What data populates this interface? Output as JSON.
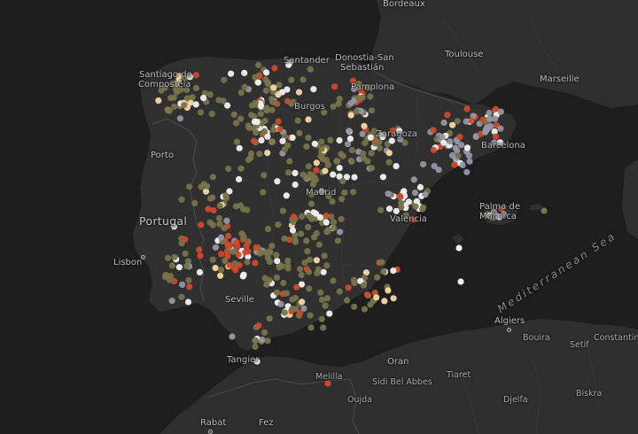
{
  "map": {
    "labels": {
      "bordeaux": "Bordeaux",
      "toulouse": "Toulouse",
      "marseille": "Marseille",
      "santiago_1": "Santiago de",
      "santiago_2": "Compostela",
      "santander": "Santander",
      "donostia_1": "Donostia-San",
      "donostia_2": "Sebastián",
      "pamplona": "Pamplona",
      "burgos": "Burgos",
      "zaragoza": "Zaragoza",
      "barcelona": "Barcelona",
      "porto": "Porto",
      "portugal": "Portugal",
      "lisbon": "Lisbon",
      "madrid": "Madrid",
      "valencia": "Valencia",
      "palma_1": "Palma de",
      "palma_2": "Mallorca",
      "seville": "Seville",
      "sea": "Mediterranean Sea",
      "algiers": "Algiers",
      "boufarik": "Bouira",
      "setif": "Setif",
      "constantine": "Constantine",
      "tangier": "Tangier",
      "oran": "Oran",
      "melilla": "Melilla",
      "sidibel": "Sidi Bel Abbes",
      "tiaret": "Tiaret",
      "oujda": "Oujda",
      "djelfa": "Djelfa",
      "biskra": "Biskra",
      "rabat": "Rabat",
      "fez": "Fez"
    }
  },
  "palette": {
    "olive": "#77734b",
    "white": "#f2f2f2",
    "red": "#cf4a2c",
    "lavender": "#9496a8",
    "cream": "#f6d8a4",
    "land": "#303030",
    "water": "#1e1e1e",
    "border": "#4a4a4a"
  }
}
